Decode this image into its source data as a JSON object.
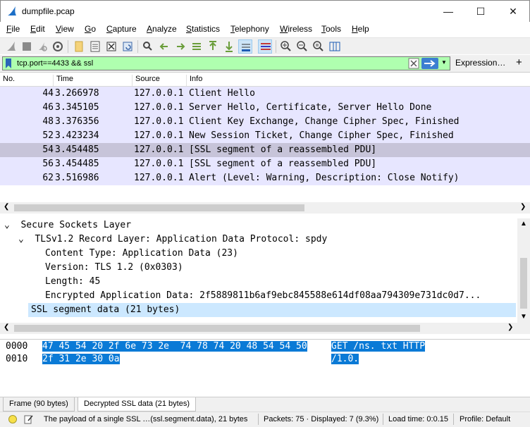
{
  "window": {
    "title": "dumpfile.pcap"
  },
  "menu": [
    "File",
    "Edit",
    "View",
    "Go",
    "Capture",
    "Analyze",
    "Statistics",
    "Telephony",
    "Wireless",
    "Tools",
    "Help"
  ],
  "filter": {
    "value": "tcp.port==4433 && ssl",
    "expression_label": "Expression…",
    "add_label": "+"
  },
  "packet_list": {
    "columns": [
      "No.",
      "Time",
      "Source",
      "Info"
    ],
    "rows": [
      {
        "no": "44",
        "time": "3.266978",
        "source": "127.0.0.1",
        "info": "Client Hello"
      },
      {
        "no": "46",
        "time": "3.345105",
        "source": "127.0.0.1",
        "info": "Server Hello, Certificate, Server Hello Done"
      },
      {
        "no": "48",
        "time": "3.376356",
        "source": "127.0.0.1",
        "info": "Client Key Exchange, Change Cipher Spec, Finished"
      },
      {
        "no": "52",
        "time": "3.423234",
        "source": "127.0.0.1",
        "info": "New Session Ticket, Change Cipher Spec, Finished"
      },
      {
        "no": "54",
        "time": "3.454485",
        "source": "127.0.0.1",
        "info": "[SSL segment of a reassembled PDU]"
      },
      {
        "no": "56",
        "time": "3.454485",
        "source": "127.0.0.1",
        "info": "[SSL segment of a reassembled PDU]"
      },
      {
        "no": "62",
        "time": "3.516986",
        "source": "127.0.0.1",
        "info": "Alert (Level: Warning, Description: Close Notify)"
      }
    ]
  },
  "details": {
    "ssl": "Secure Sockets Layer",
    "record": "TLSv1.2 Record Layer: Application Data Protocol: spdy",
    "content_type": "Content Type: Application Data (23)",
    "version": "Version: TLS 1.2 (0x0303)",
    "length": "Length: 45",
    "encrypted": "Encrypted Application Data: 2f5889811b6af9ebc845588e614df08aa794309e731dc0d7...",
    "segment": "SSL segment data (21 bytes)"
  },
  "bytes": [
    {
      "offset": "0000",
      "hex": "47 45 54 20 2f 6e 73 2e  74 78 74 20 48 54 54 50",
      "ascii": "GET /ns. txt HTTP"
    },
    {
      "offset": "0010",
      "hex": "2f 31 2e 30 0a",
      "ascii": "/1.0."
    }
  ],
  "byte_tabs": [
    "Frame (90 bytes)",
    "Decrypted SSL data (21 bytes)"
  ],
  "status": {
    "message": "The payload of a single SSL …(ssl.segment.data), 21 bytes",
    "packets": "Packets: 75 · Displayed: 7 (9.3%)",
    "load_time": "Load time: 0:0.15",
    "profile": "Profile: Default"
  },
  "icons": [
    "shark-fin-icon",
    "start-capture-icon",
    "stop-capture-icon",
    "restart-capture-icon",
    "capture-options-icon",
    "open-file-icon",
    "save-file-icon",
    "close-file-icon",
    "reload-file-icon",
    "find-packet-icon",
    "go-back-icon",
    "go-forward-icon",
    "go-to-packet-icon",
    "first-packet-icon",
    "last-packet-icon",
    "autoscroll-icon",
    "colorize-icon",
    "zoom-in-icon",
    "zoom-out-icon",
    "zoom-normal-icon",
    "resize-columns-icon",
    "bookmark-icon",
    "clear-filter-icon",
    "apply-filter-icon",
    "expert-info-icon",
    "edit-comment-icon"
  ],
  "colors": {
    "filter_valid": "#afffaf",
    "row_bg": "#e7e6ff",
    "row_selected": "#c7c4d9",
    "detail_highlight": "#cce8ff",
    "byte_highlight": "#0a7ad6"
  }
}
